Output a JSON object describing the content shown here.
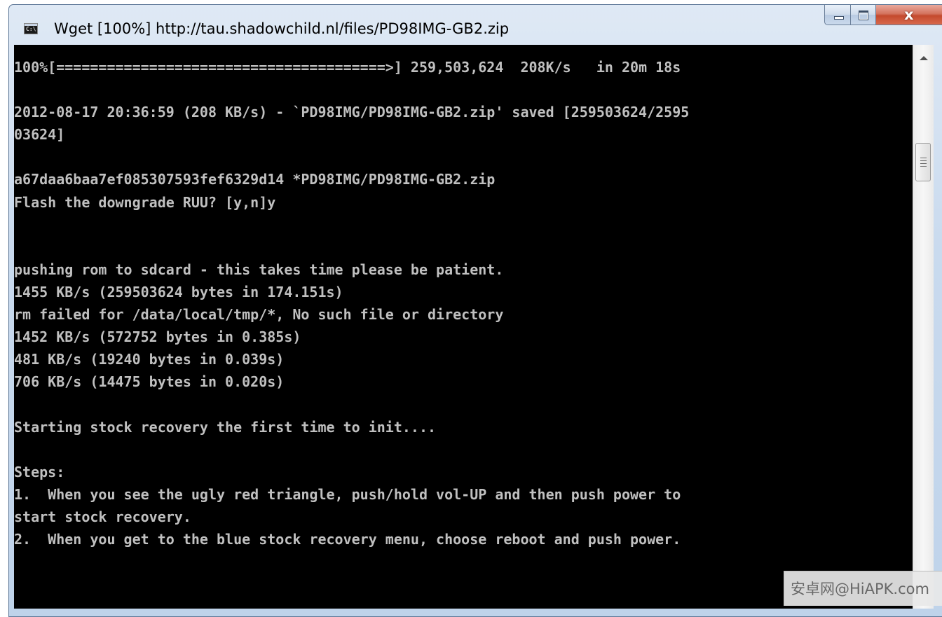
{
  "window": {
    "title": "Wget [100%] http://tau.shadowchild.nl/files/PD98IMG-GB2.zip",
    "icon": "console-app-icon",
    "icon_label": "C:\\",
    "controls": {
      "minimize": "minimize-icon",
      "maximize": "maximize-icon",
      "close_glyph": "x"
    }
  },
  "console": {
    "lines": [
      "100%[=======================================>] 259,503,624  208K/s   in 20m 18s",
      "",
      "2012-08-17 20:36:59 (208 KB/s) - `PD98IMG/PD98IMG-GB2.zip' saved [259503624/2595",
      "03624]",
      "",
      "a67daa6baa7ef085307593fef6329d14 *PD98IMG/PD98IMG-GB2.zip",
      "Flash the downgrade RUU? [y,n]y",
      "",
      "",
      "pushing rom to sdcard - this takes time please be patient.",
      "1455 KB/s (259503624 bytes in 174.151s)",
      "rm failed for /data/local/tmp/*, No such file or directory",
      "1452 KB/s (572752 bytes in 0.385s)",
      "481 KB/s (19240 bytes in 0.039s)",
      "706 KB/s (14475 bytes in 0.020s)",
      "",
      "Starting stock recovery the first time to init....",
      "",
      "Steps:",
      "1.  When you see the ugly red triangle, push/hold vol-UP and then push power to",
      "start stock recovery.",
      "2.  When you get to the blue stock recovery menu, choose reboot and push power."
    ]
  },
  "scrollbar": {
    "up_arrow": "scroll-up-arrow-icon",
    "thumb": "scroll-thumb-grip-icon"
  },
  "watermark": {
    "text": "安卓网@HiAPK.com"
  },
  "colors": {
    "console_bg": "#000000",
    "console_fg": "#c0c0c0",
    "close_button": "#c44a2e",
    "frame": "#c9daee"
  }
}
